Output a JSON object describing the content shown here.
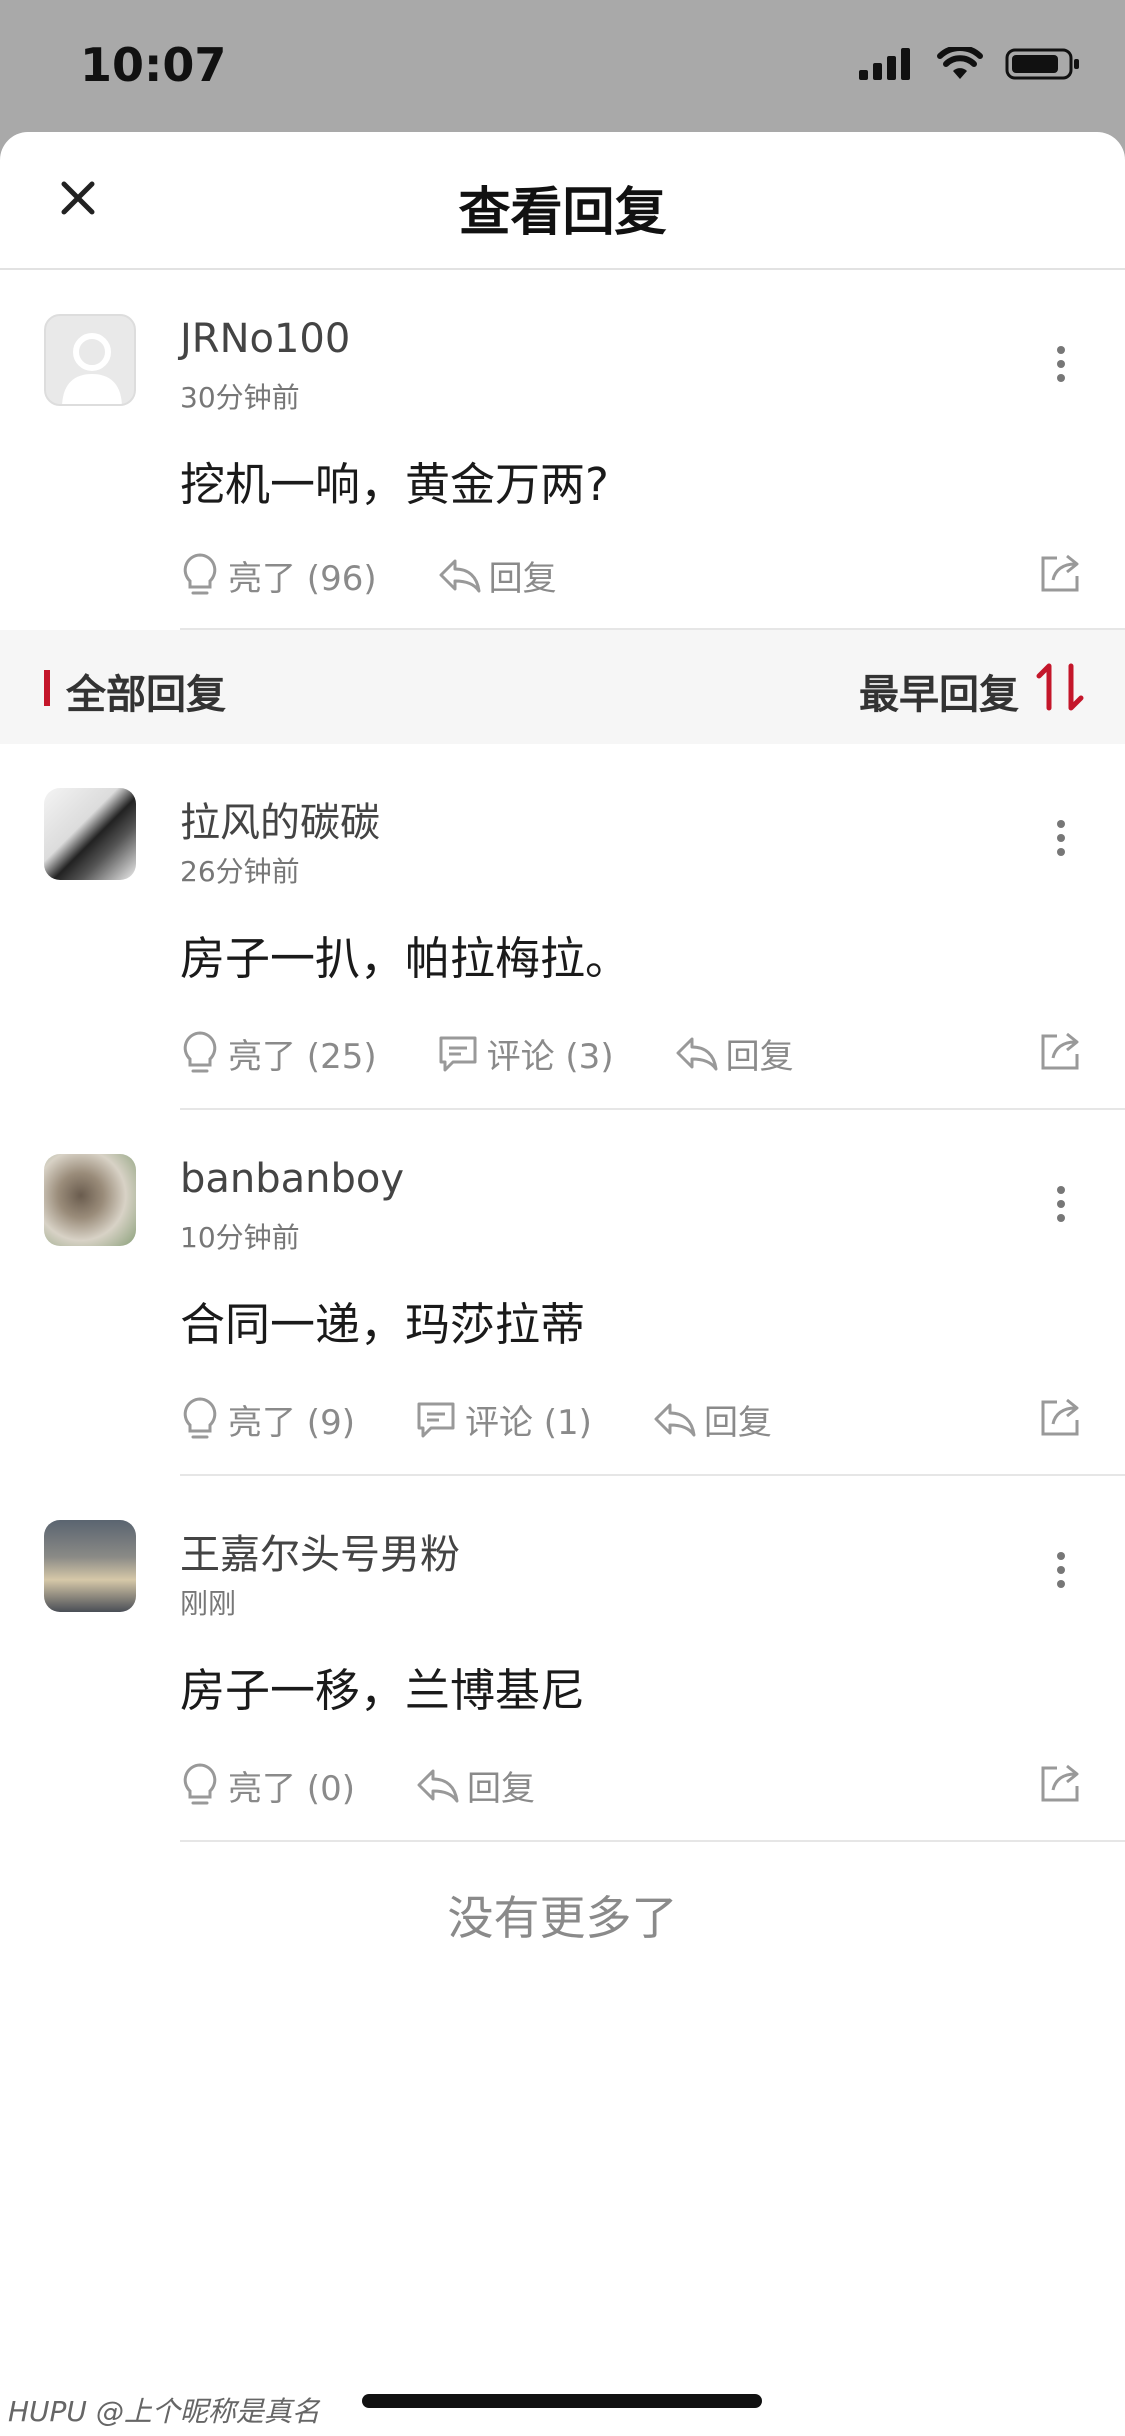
{
  "status_bar": {
    "time": "10:07"
  },
  "nav": {
    "title": "查看回复"
  },
  "main_post": {
    "username": "JRNo100",
    "time": "30分钟前",
    "content": "挖机一响，黄金万两?",
    "light": "亮了 (96)",
    "reply": "回复"
  },
  "section": {
    "title": "全部回复",
    "sort_label": "最早回复"
  },
  "replies": [
    {
      "username": "拉风的碳碳",
      "time": "26分钟前",
      "content": "房子一扒，帕拉梅拉。",
      "light": "亮了 (25)",
      "comment": "评论 (3)",
      "reply": "回复"
    },
    {
      "username": "banbanboy",
      "time": "10分钟前",
      "content": "合同一递，玛莎拉蒂",
      "light": "亮了 (9)",
      "comment": "评论 (1)",
      "reply": "回复"
    },
    {
      "username": "王嘉尔头号男粉",
      "time": "刚刚",
      "content": "房子一移，兰博基尼",
      "light": "亮了 (0)",
      "reply": "回复"
    }
  ],
  "footer": {
    "no_more": "没有更多了"
  },
  "watermark": "HUPU @上个昵称是真名",
  "colors": {
    "accent": "#c4162a"
  }
}
